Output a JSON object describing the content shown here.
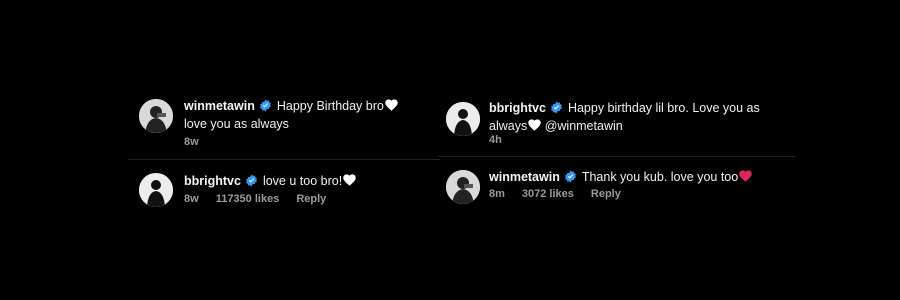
{
  "left_panel": {
    "comment": {
      "username": "winmetawin",
      "text": "Happy Birthday bro",
      "text2": "love you as always",
      "time": "8w"
    },
    "reply": {
      "username": "bbrightvc",
      "text": "love u too bro!",
      "time": "8w",
      "likes": "117350 likes",
      "reply_label": "Reply"
    }
  },
  "right_panel": {
    "comment": {
      "username": "bbrightvc",
      "text": "Happy birthday lil bro. Love you as",
      "text2": "always",
      "mention": "@winmetawin",
      "time": "4h"
    },
    "reply": {
      "username": "winmetawin",
      "text": "Thank you kub. love you too",
      "time": "8m",
      "likes": "3072 likes",
      "reply_label": "Reply"
    }
  },
  "colors": {
    "background": "#000000",
    "verified_badge": "#3897f0",
    "heart_white": "#ffffff",
    "heart_red": "#e0245e",
    "meta_text": "#9a9a9a"
  },
  "icons": {
    "verified": "verified-badge-icon",
    "white_heart": "white-heart-icon",
    "red_heart": "red-heart-icon"
  }
}
